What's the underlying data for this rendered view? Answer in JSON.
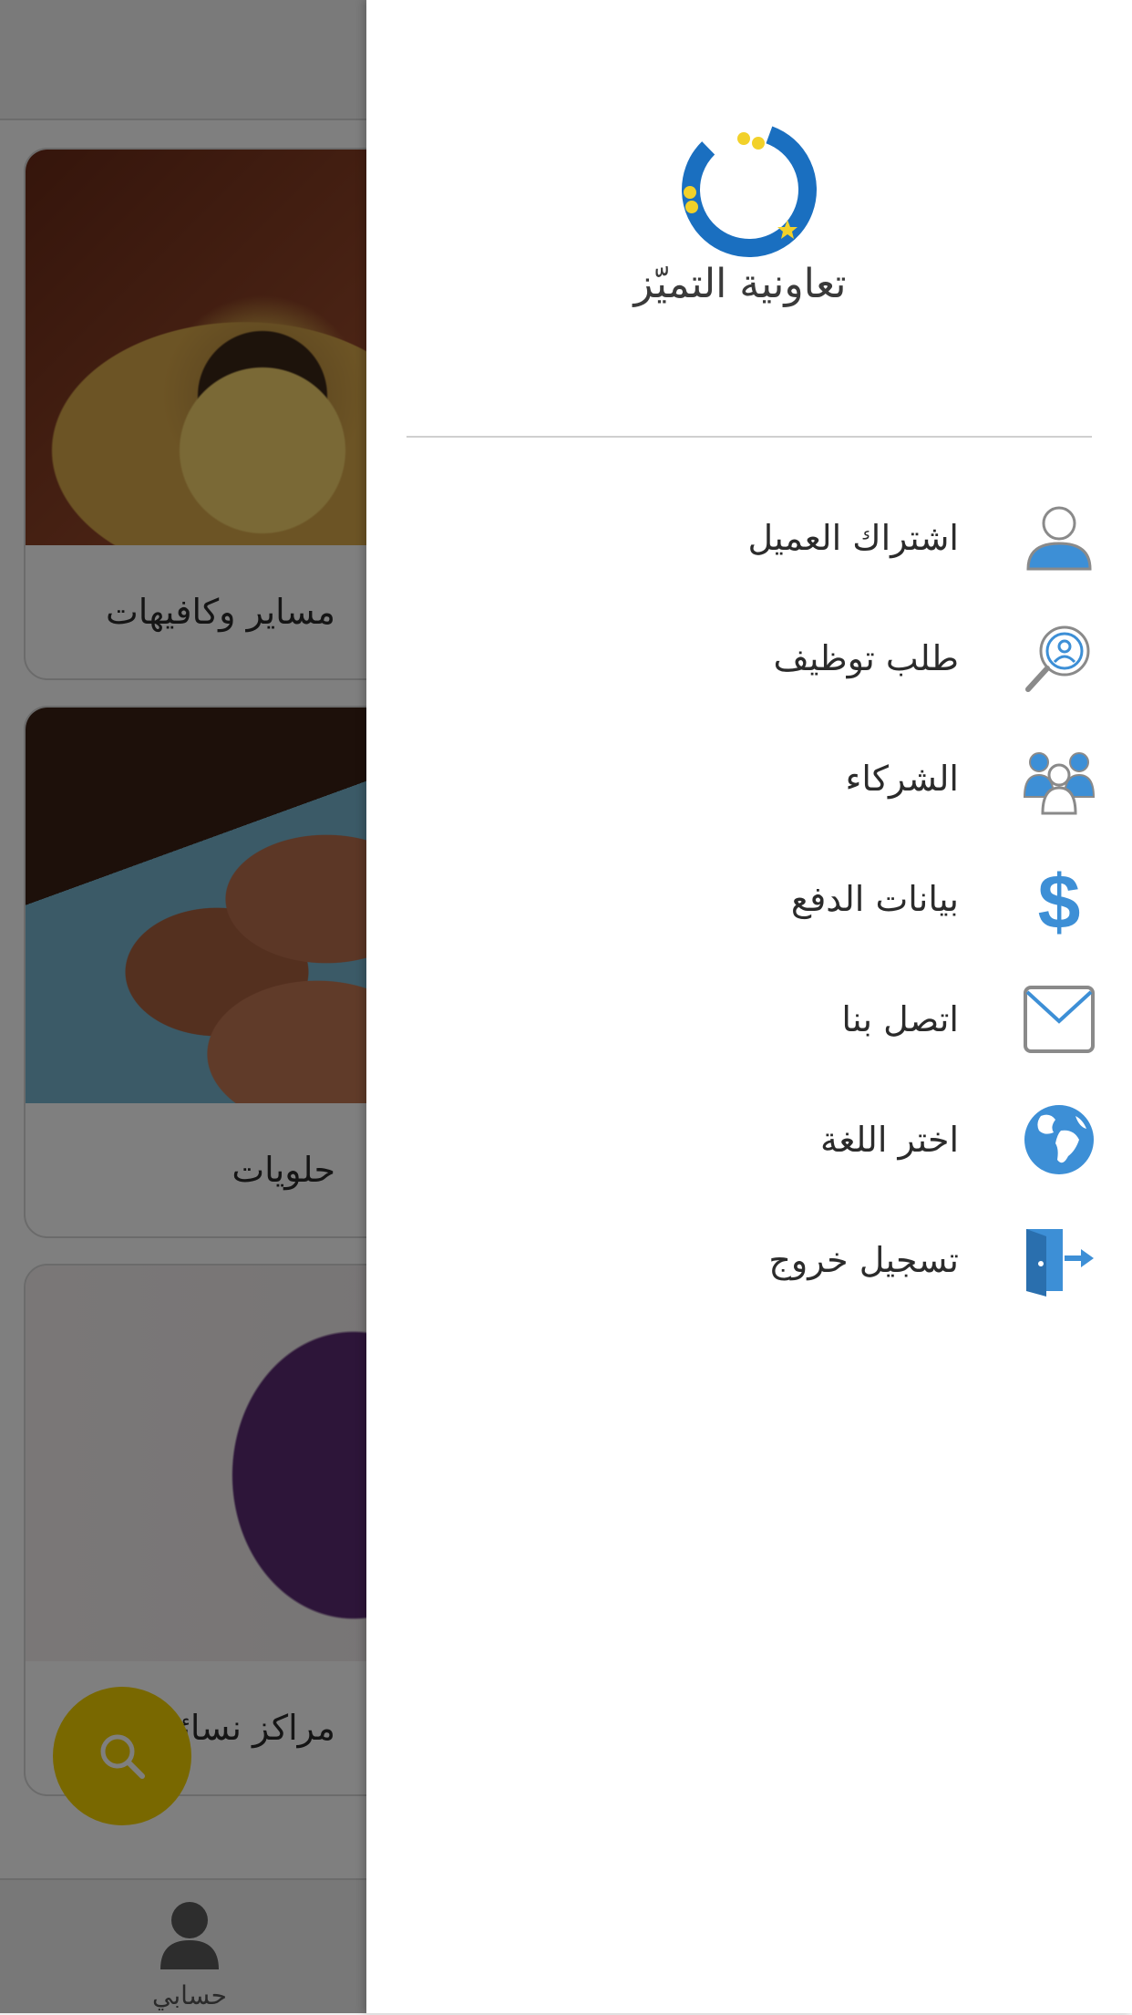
{
  "background": {
    "cards": [
      {
        "title": "مساير وكافيهات",
        "image": "coffee-photo"
      },
      {
        "title": "حلويات",
        "image": "sweets-photo"
      },
      {
        "title": "مراكز نسائية",
        "image": "women-hair-photo"
      }
    ],
    "fab_icon": "search-icon",
    "bottom_nav": {
      "account_label": "حسابي",
      "account_icon": "person-icon"
    }
  },
  "drawer": {
    "logo_text": "تعاونية التميّز",
    "logo_colors": {
      "ring": "#1a6fc0",
      "dots": "#f2d12a"
    },
    "menu": [
      {
        "label": "اشتراك العميل",
        "icon": "user-icon"
      },
      {
        "label": "طلب توظيف",
        "icon": "job-search-icon"
      },
      {
        "label": "الشركاء",
        "icon": "partners-icon"
      },
      {
        "label": "بيانات الدفع",
        "icon": "dollar-icon"
      },
      {
        "label": "اتصل بنا",
        "icon": "mail-icon"
      },
      {
        "label": "اختر اللغة",
        "icon": "globe-icon"
      },
      {
        "label": "تسجيل خروج",
        "icon": "logout-icon"
      }
    ],
    "icon_color": "#3d8fd6"
  }
}
